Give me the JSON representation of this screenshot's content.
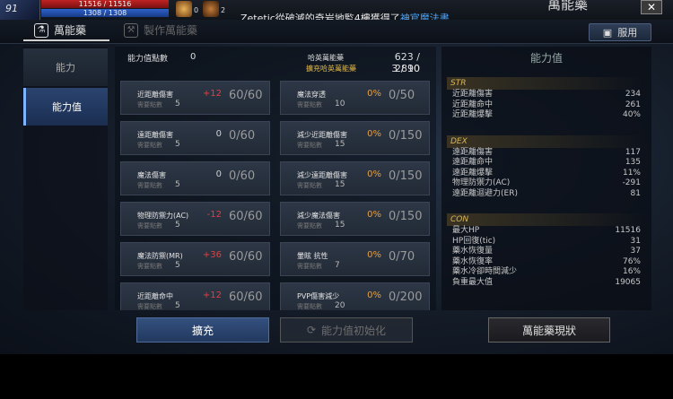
{
  "hud": {
    "level": "91",
    "hp_text": "11516 / 11516",
    "mp_text": "1308 / 1308",
    "buff_count_1": "0",
    "buff_count_2": "2",
    "notification_prefix": "Zetetic從破滅的奇岩地監4樓獲得了",
    "notification_item": "神官魔法書",
    "notification_suffix": ".",
    "window_title": "萬能藥",
    "close_label": "✕"
  },
  "tabs": {
    "potion_tab": "萬能藥",
    "craft_tab": "製作萬能藥"
  },
  "use_button": "服用",
  "sidebar": {
    "items": [
      "能力",
      "能力值"
    ],
    "selected": "能力值"
  },
  "summary": {
    "points_label": "能力值點數",
    "points_value": "0",
    "exp_label": "哈英萬能藥",
    "exp_value": "623 / 2890",
    "expand_label": "擴充哈英萬能藥",
    "expand_value": "3 / 10"
  },
  "stat_cards": [
    {
      "name": "近距離傷害",
      "req_label": "需要點數",
      "req": "5",
      "bonus": "+12",
      "value": "60/60"
    },
    {
      "name": "魔法穿透",
      "req_label": "需要點數",
      "req": "10",
      "bonus": "0%",
      "value": "0/50"
    },
    {
      "name": "遠距離傷害",
      "req_label": "需要點數",
      "req": "5",
      "bonus": "0",
      "value": "0/60"
    },
    {
      "name": "減少近距離傷害",
      "req_label": "需要點數",
      "req": "15",
      "bonus": "0%",
      "value": "0/150"
    },
    {
      "name": "魔法傷害",
      "req_label": "需要點數",
      "req": "5",
      "bonus": "0",
      "value": "0/60"
    },
    {
      "name": "減少遠距離傷害",
      "req_label": "需要點數",
      "req": "15",
      "bonus": "0%",
      "value": "0/150"
    },
    {
      "name": "物理防禦力(AC)",
      "req_label": "需要點數",
      "req": "5",
      "bonus": "-12",
      "value": "60/60"
    },
    {
      "name": "減少魔法傷害",
      "req_label": "需要點數",
      "req": "15",
      "bonus": "0%",
      "value": "0/150"
    },
    {
      "name": "魔法防禦(MR)",
      "req_label": "需要點數",
      "req": "5",
      "bonus": "+36",
      "value": "60/60"
    },
    {
      "name": "暈眩 抗性",
      "req_label": "需要點數",
      "req": "7",
      "bonus": "0%",
      "value": "0/70"
    },
    {
      "name": "近距離命中",
      "req_label": "需要點數",
      "req": "5",
      "bonus": "+12",
      "value": "60/60"
    },
    {
      "name": "PVP傷害減少",
      "req_label": "需要點數",
      "req": "20",
      "bonus": "0%",
      "value": "0/200"
    }
  ],
  "ability_panel": {
    "title": "能力值",
    "sections": [
      {
        "name": "STR",
        "rows": [
          {
            "label": "近距離傷害",
            "value": "234"
          },
          {
            "label": "近距離命中",
            "value": "261"
          },
          {
            "label": "近距離爆擊",
            "value": "40%"
          }
        ]
      },
      {
        "name": "DEX",
        "rows": [
          {
            "label": "遠距離傷害",
            "value": "117"
          },
          {
            "label": "遠距離命中",
            "value": "135"
          },
          {
            "label": "遠距離爆擊",
            "value": "11%"
          },
          {
            "label": "物理防禦力(AC)",
            "value": "-291"
          },
          {
            "label": "遠距離迴避力(ER)",
            "value": "81"
          }
        ]
      },
      {
        "name": "CON",
        "rows": [
          {
            "label": "最大HP",
            "value": "11516"
          },
          {
            "label": "HP回復(tic)",
            "value": "31"
          },
          {
            "label": "藥水恢復量",
            "value": "37"
          },
          {
            "label": "藥水恢復率",
            "value": "76%"
          },
          {
            "label": "藥水冷卻時間減少",
            "value": "16%"
          },
          {
            "label": "負重最大值",
            "value": "19065"
          }
        ]
      }
    ]
  },
  "bottom": {
    "expand_button": "擴充",
    "reset_button": "能力值初始化",
    "status_button": "萬能藥現狀"
  },
  "colors": {
    "accent_blue": "#4aa7ff",
    "bonus_positive": "#e04040",
    "section_header": "#d9b75a",
    "hp": "#c02323",
    "mp": "#2e62c9"
  }
}
